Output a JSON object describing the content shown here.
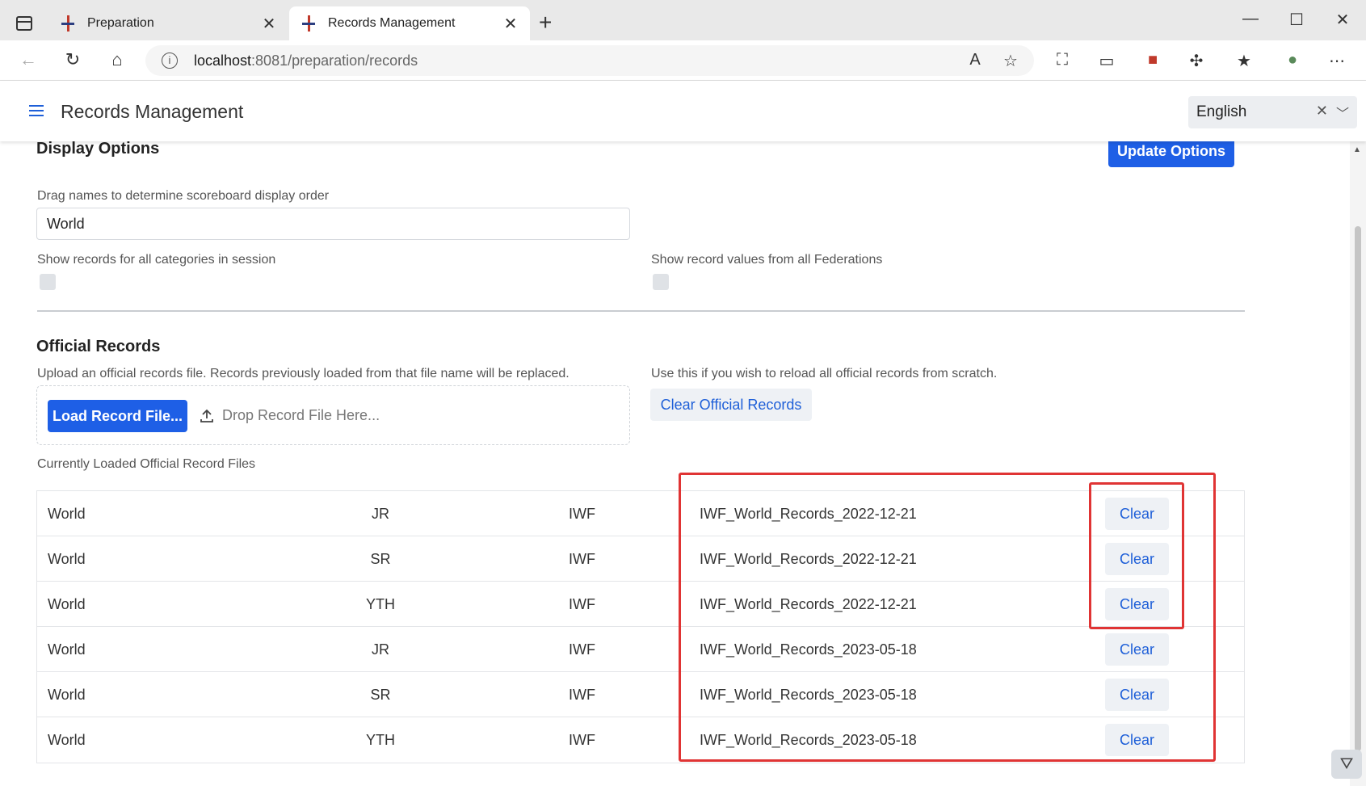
{
  "browser": {
    "tabs": [
      {
        "label": "Preparation",
        "active": false
      },
      {
        "label": "Records Management",
        "active": true
      }
    ],
    "url_host": "localhost",
    "url_rest": ":8081/preparation/records"
  },
  "app": {
    "title": "Records Management",
    "language": "English"
  },
  "display_options": {
    "heading": "Display Options",
    "update_button": "Update Options",
    "order_label": "Drag names to determine scoreboard display order",
    "order_value": "World",
    "all_categories_label": "Show records for all categories in session",
    "all_federations_label": "Show record values from all Federations"
  },
  "official_records": {
    "heading": "Official Records",
    "upload_help": "Upload an official records file. Records previously loaded from that file name will be replaced.",
    "load_button": "Load Record File...",
    "drop_text": "Drop Record File Here...",
    "clear_help": "Use this if you wish to reload all official records from scratch.",
    "clear_all_button": "Clear Official Records",
    "loaded_label": "Currently Loaded Official Record Files",
    "rows": [
      {
        "name": "World",
        "age": "JR",
        "fed": "IWF",
        "file": "IWF_World_Records_2022-12-21",
        "action": "Clear"
      },
      {
        "name": "World",
        "age": "SR",
        "fed": "IWF",
        "file": "IWF_World_Records_2022-12-21",
        "action": "Clear"
      },
      {
        "name": "World",
        "age": "YTH",
        "fed": "IWF",
        "file": "IWF_World_Records_2022-12-21",
        "action": "Clear"
      },
      {
        "name": "World",
        "age": "JR",
        "fed": "IWF",
        "file": "IWF_World_Records_2023-05-18",
        "action": "Clear"
      },
      {
        "name": "World",
        "age": "SR",
        "fed": "IWF",
        "file": "IWF_World_Records_2023-05-18",
        "action": "Clear"
      },
      {
        "name": "World",
        "age": "YTH",
        "fed": "IWF",
        "file": "IWF_World_Records_2023-05-18",
        "action": "Clear"
      }
    ]
  },
  "colors": {
    "primary": "#1e5fe6",
    "highlight": "#e03434"
  }
}
